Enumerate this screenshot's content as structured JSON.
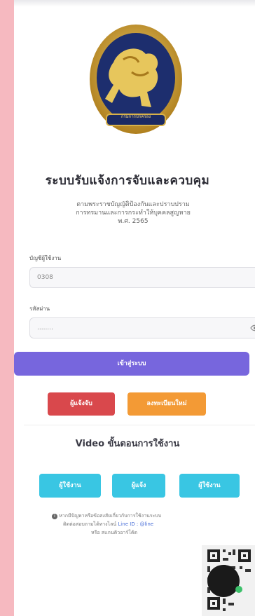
{
  "header": {
    "title": "ระบบรับแจ้งการจับและควบคุม",
    "subtitle_lines": [
      "ตามพระราชบัญญัติป้องกันและปราบปราม",
      "การทรมานและการกระทำให้บุคคลสูญหาย",
      "พ.ศ. 2565"
    ],
    "emblem_text": "กรมการปกครอง"
  },
  "form": {
    "username_label": "บัญชีผู้ใช้งาน",
    "username_value": "0308",
    "password_label": "รหัสผ่าน",
    "password_value": "........",
    "login_label": "เข้าสู่ระบบ"
  },
  "actions": {
    "notify_label": "ผู้แจ้งจับ",
    "register_label": "ลงทะเบียนใหม่"
  },
  "videos": {
    "title": "Video ขั้นตอนการใช้งาน",
    "buttons": [
      "ผู้ใช้งาน",
      "ผู้แจ้ง",
      "ผู้ใช้งาน"
    ]
  },
  "footer": {
    "line1": "หากมีปัญหาหรือข้อสงสัยเกี่ยวกับการใช้งานระบบ",
    "line2": "ติดต่อสอบถามได้ทางไลน์",
    "line_id_label": "Line ID : @line",
    "line3": "หรือ สแกนคิวอาร์โค้ด"
  },
  "colors": {
    "background": "#f6b9c0",
    "primary": "#7766dd",
    "danger": "#d9484c",
    "warning": "#f39a35",
    "info": "#39c6e3"
  },
  "icons": [
    "eye-icon",
    "info-icon",
    "qr-code",
    "chat-bubble-icon"
  ]
}
